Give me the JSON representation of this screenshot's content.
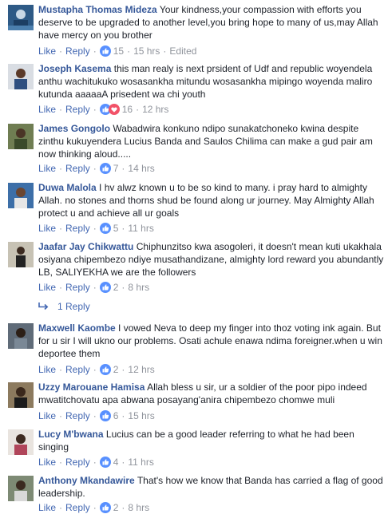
{
  "labels": {
    "like": "Like",
    "reply": "Reply",
    "dot": "·"
  },
  "colors": {
    "name": "#365899",
    "link": "#4267b2",
    "meta": "#90949c",
    "text": "#1d2129",
    "like": "#5890ff",
    "love": "#f25268"
  },
  "comments": [
    {
      "name": "Mustapha Thomas Mideza",
      "text": "Your kindness,your compassion with efforts you deserve to be upgraded to another level,you bring hope to many of us,may Allah have mercy on you brother",
      "reaction_icons": [
        "like-icon"
      ],
      "reaction_count": "15",
      "time": "15 hrs",
      "edited": "Edited"
    },
    {
      "name": "Joseph Kasema",
      "text": "this man realy is next prsident of Udf and republic woyendela anthu wachitukuko wosasankha mitundu wosasankha mipingo woyenda maliro kutunda aaaaaA prisedent wa chi youth",
      "reaction_icons": [
        "like-icon",
        "love-icon"
      ],
      "reaction_count": "16",
      "time": "12 hrs"
    },
    {
      "name": "James Gongolo",
      "text": "Wabadwira konkuno ndipo sunakatchoneko kwina despite zinthu kukuyendera Lucius Banda and Saulos Chilima can make a gud pair am now thinking aloud.....",
      "reaction_icons": [
        "like-icon"
      ],
      "reaction_count": "7",
      "time": "14 hrs"
    },
    {
      "name": "Duwa Malola",
      "text": "I hv alwz known u to be so kind to many. i pray hard to almighty Allah. no stones and thorns shud be found along ur journey. May Almighty Allah protect u and achieve all ur goals",
      "reaction_icons": [
        "like-icon"
      ],
      "reaction_count": "5",
      "time": "11 hrs"
    },
    {
      "name": "Jaafar Jay Chikwattu",
      "text": "Chiphunzitso kwa asogoleri, it doesn't mean kuti ukakhala osiyana chipembezo ndiye musathandizane, almighty lord reward you abundantly LB, SALIYEKHA we are the followers",
      "reaction_icons": [
        "like-icon"
      ],
      "reaction_count": "2",
      "time": "8 hrs",
      "replies": "1 Reply"
    },
    {
      "name": "Maxwell Kaombe",
      "text": "I vowed Neva to deep my finger into thoz voting ink again. But for u sir I will ukno our problems. Osati achule enawa ndima foreigner.when u win deportee them",
      "reaction_icons": [
        "like-icon"
      ],
      "reaction_count": "2",
      "time": "12 hrs"
    },
    {
      "name": "Uzzy Marouane Hamisa",
      "text": "Allah bless u sir, ur a soldier of the poor pipo indeed mwatitchovatu apa abwana posayang'anira chipembezo chomwe muli",
      "reaction_icons": [
        "like-icon"
      ],
      "reaction_count": "6",
      "time": "15 hrs"
    },
    {
      "name": "Lucy M'bwana",
      "text": "Lucius can be a good leader referring to what he had been singing",
      "reaction_icons": [
        "like-icon"
      ],
      "reaction_count": "4",
      "time": "11 hrs"
    },
    {
      "name": "Anthony Mkandawire",
      "text": "That's how we know that Banda has carried a flag of good leadership.",
      "reaction_icons": [
        "like-icon"
      ],
      "reaction_count": "2",
      "time": "8 hrs"
    }
  ]
}
